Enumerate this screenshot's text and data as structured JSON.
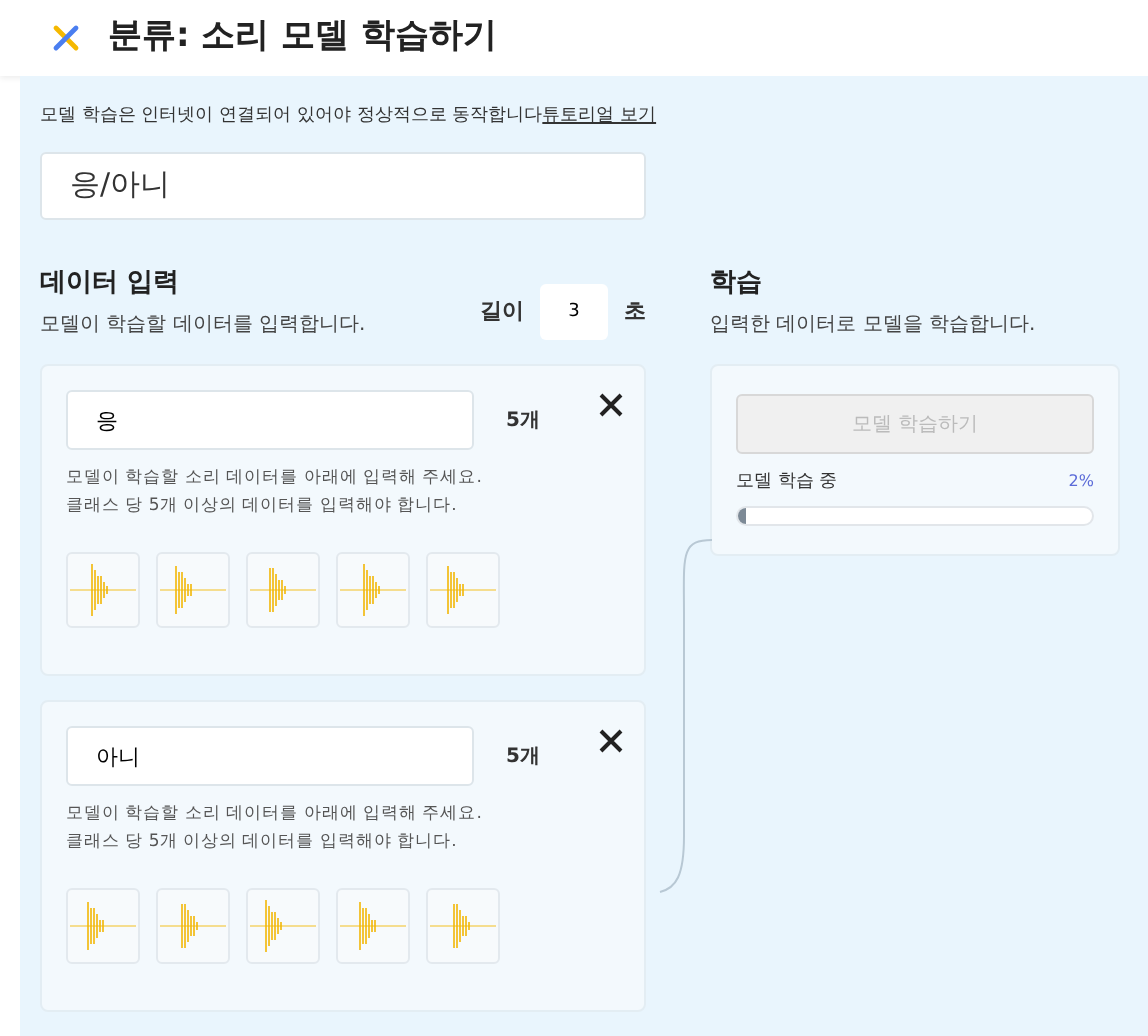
{
  "header": {
    "title": "분류: 소리 모델 학습하기"
  },
  "notice": {
    "text": "모델 학습은 인터넷이 연결되어 있어야 정상적으로 동작합니다",
    "link": "튜토리얼 보기"
  },
  "model_name": {
    "value": "응/아니"
  },
  "data_input": {
    "title": "데이터 입력",
    "description": "모델이 학습할 데이터를 입력합니다.",
    "length_label": "길이",
    "length_value": "3",
    "length_unit": "초",
    "classes": [
      {
        "name": "응",
        "count": "5개",
        "help": [
          "모델이 학습할 소리 데이터를 아래에 입력해 주세요.",
          "클래스 당 5개 이상의 데이터를 입력해야 합니다."
        ],
        "samples": [
          {
            "kind": "waveform"
          },
          {
            "kind": "waveform"
          },
          {
            "kind": "waveform"
          },
          {
            "kind": "waveform"
          },
          {
            "kind": "waveform"
          }
        ]
      },
      {
        "name": "아니",
        "count": "5개",
        "help": [
          "모델이 학습할 소리 데이터를 아래에 입력해 주세요.",
          "클래스 당 5개 이상의 데이터를 입력해야 합니다."
        ],
        "samples": [
          {
            "kind": "waveform"
          },
          {
            "kind": "waveform"
          },
          {
            "kind": "waveform"
          },
          {
            "kind": "waveform"
          },
          {
            "kind": "waveform"
          }
        ]
      }
    ]
  },
  "training": {
    "title": "학습",
    "description": "입력한 데이터로 모델을 학습합니다.",
    "button": {
      "label": "모델 학습하기",
      "disabled": true
    },
    "progress_label": "모델 학습 중",
    "progress_reading": "2%",
    "level": 0.02
  }
}
